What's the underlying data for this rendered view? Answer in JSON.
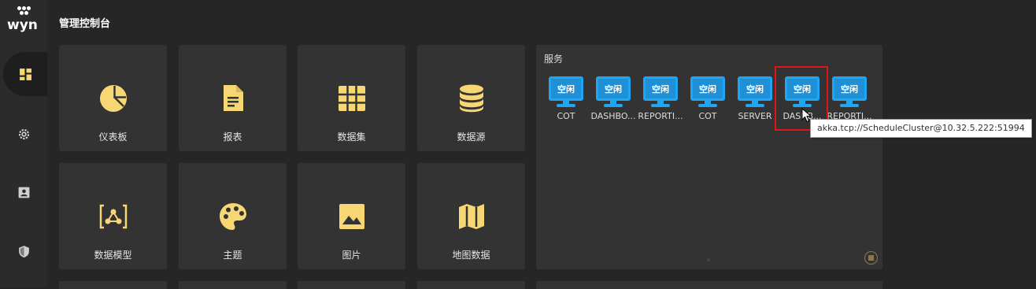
{
  "brand": {
    "logo_text": "wyn"
  },
  "sidebar": {
    "items": [
      {
        "name": "dashboard",
        "icon": "dashboard-icon",
        "active": true
      },
      {
        "name": "settings",
        "icon": "gear-icon",
        "active": false
      },
      {
        "name": "account",
        "icon": "contact-card-icon",
        "active": false
      },
      {
        "name": "security",
        "icon": "shield-icon",
        "active": false
      }
    ]
  },
  "header": {
    "title": "管理控制台"
  },
  "tiles": [
    {
      "label": "仪表板",
      "icon": "pie-chart-icon"
    },
    {
      "label": "报表",
      "icon": "document-icon"
    },
    {
      "label": "数据集",
      "icon": "grid-table-icon"
    },
    {
      "label": "数据源",
      "icon": "database-icon"
    },
    {
      "label": "数据模型",
      "icon": "data-model-icon"
    },
    {
      "label": "主题",
      "icon": "palette-icon"
    },
    {
      "label": "图片",
      "icon": "image-icon"
    },
    {
      "label": "地图数据",
      "icon": "map-icon"
    }
  ],
  "services": {
    "title": "服务",
    "items": [
      {
        "status": "空闲",
        "name": "COT"
      },
      {
        "status": "空闲",
        "name": "DASHBO..."
      },
      {
        "status": "空闲",
        "name": "REPORTI..."
      },
      {
        "status": "空闲",
        "name": "COT"
      },
      {
        "status": "空闲",
        "name": "SERVER"
      },
      {
        "status": "空闲",
        "name": "DASHB..."
      },
      {
        "status": "空闲",
        "name": "REPORTI..."
      }
    ],
    "tooltip": "akka.tcp://ScheduleCluster@10.32.5.222:51994"
  },
  "colors": {
    "accent_yellow": "#f7d774",
    "monitor_blue": "#1ea6f5",
    "highlight_red": "#e01515"
  }
}
